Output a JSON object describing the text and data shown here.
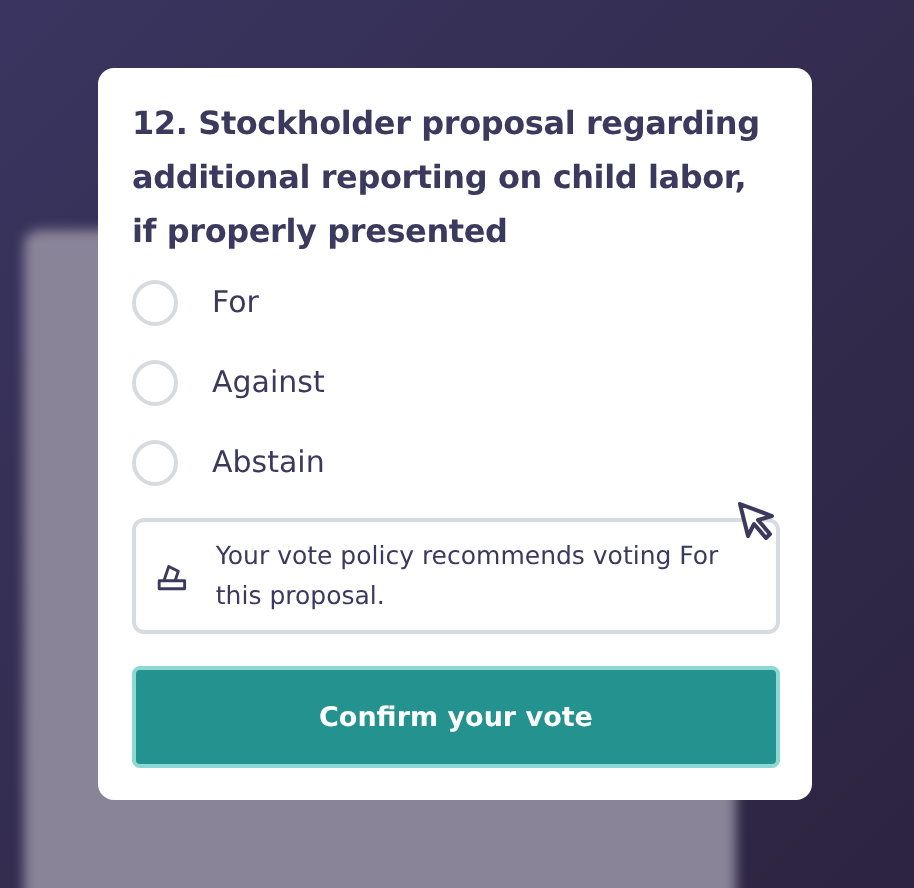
{
  "proposal": {
    "title": "12. Stockholder proposal regarding additional reporting on child labor, if properly presented"
  },
  "options": [
    {
      "label": "For",
      "selected": false
    },
    {
      "label": "Against",
      "selected": false
    },
    {
      "label": "Abstain",
      "selected": false
    }
  ],
  "recommendation": {
    "text": "Your vote policy recommends voting For this proposal."
  },
  "confirm_button": {
    "label": "Confirm your vote"
  }
}
